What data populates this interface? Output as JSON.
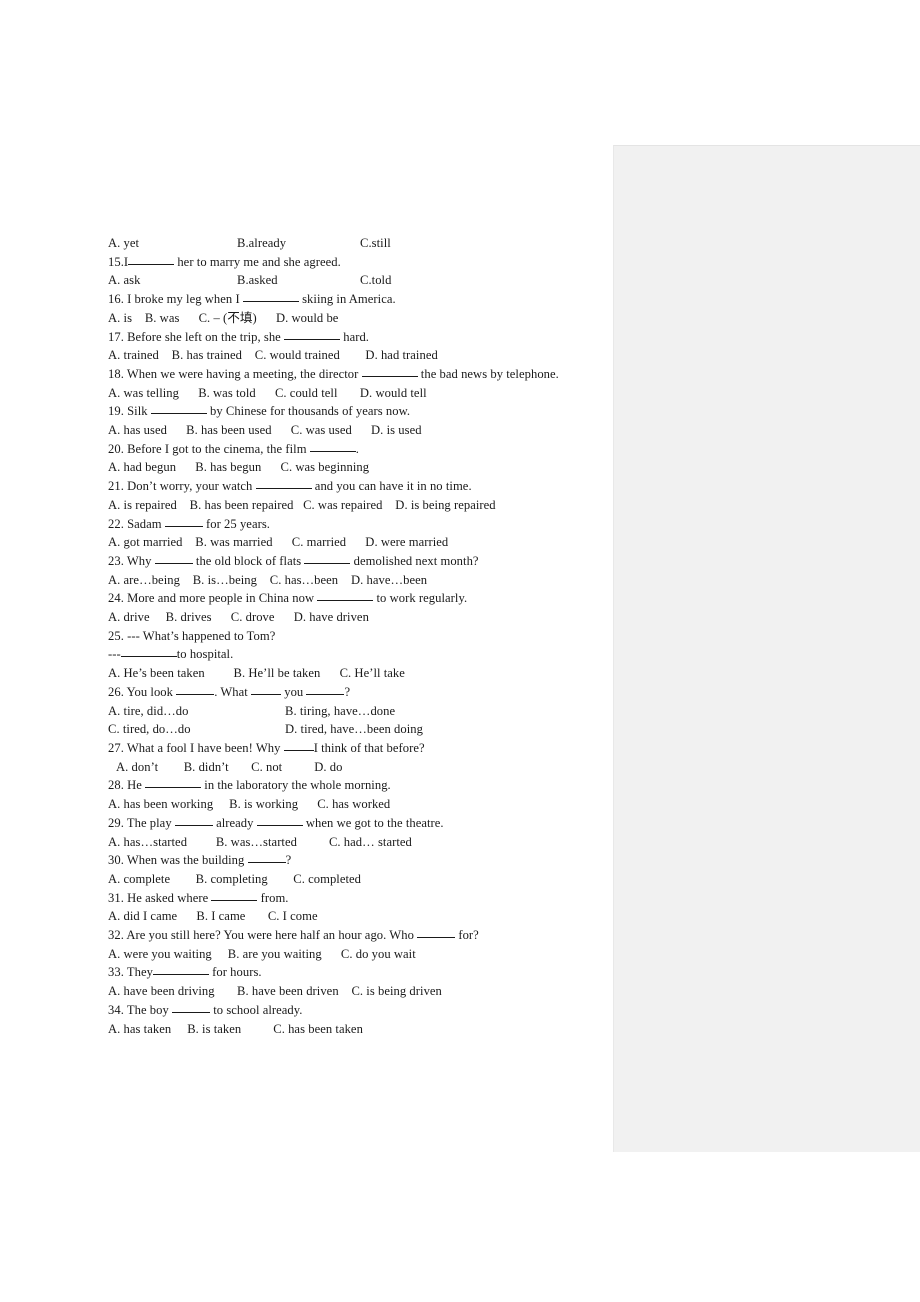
{
  "document": {
    "type": "english-grammar-worksheet",
    "page_background": "#ffffff",
    "side_panel_color": "#f1f1f1",
    "text_color": "#1a1a1a"
  },
  "lines": [
    {
      "id": "l1",
      "kind": "options",
      "text": "A. yet",
      "col2": "B.already",
      "col3": "C.still"
    },
    {
      "id": "l2",
      "kind": "question",
      "num": "15.I",
      "pre": "15.I",
      "post": " her to marry me and she agreed."
    },
    {
      "id": "l3",
      "kind": "options",
      "text": "A. ask",
      "col2": "B.asked",
      "col3": "C.told"
    },
    {
      "id": "l4",
      "kind": "question",
      "pre": "16. I broke my leg when I ",
      "post": " skiing in America."
    },
    {
      "id": "l5",
      "kind": "options",
      "text": "A. is    B. was      C. – (不填)      D. would be"
    },
    {
      "id": "l6",
      "kind": "question",
      "pre": "17. Before she left on the trip, she ",
      "post": " hard."
    },
    {
      "id": "l7",
      "kind": "options",
      "text": "A. trained    B. has trained    C. would trained        D. had trained"
    },
    {
      "id": "l8",
      "kind": "question",
      "pre": "18. When we were having a meeting, the director ",
      "post": " the bad news by telephone."
    },
    {
      "id": "l9",
      "kind": "options",
      "text": "A. was telling      B. was told      C. could tell       D. would tell"
    },
    {
      "id": "l10",
      "kind": "question",
      "pre": "19. Silk ",
      "post": " by Chinese for thousands of years now."
    },
    {
      "id": "l11",
      "kind": "options",
      "text": "A. has used      B. has been used      C. was used      D. is used"
    },
    {
      "id": "l12",
      "kind": "question",
      "pre": "20. Before I got to the cinema, the film ",
      "post": "."
    },
    {
      "id": "l13",
      "kind": "options",
      "text": "A. had begun      B. has begun      C. was beginning"
    },
    {
      "id": "l14",
      "kind": "question",
      "pre": "21. Don’t worry, your watch ",
      "post": " and you can have it in no time."
    },
    {
      "id": "l15",
      "kind": "options",
      "text": "A. is repaired    B. has been repaired   C. was repaired    D. is being repaired"
    },
    {
      "id": "l16",
      "kind": "question",
      "pre": "22. Sadam ",
      "post": " for 25 years."
    },
    {
      "id": "l17",
      "kind": "options",
      "text": "A. got married    B. was married      C. married      D. were married"
    },
    {
      "id": "l18",
      "kind": "question",
      "pre": "23. Why ",
      "mid": " the old block of flats ",
      "post": " demolished next month?"
    },
    {
      "id": "l19",
      "kind": "options",
      "text": "A. are…being    B. is…being    C. has…been    D. have…been"
    },
    {
      "id": "l20",
      "kind": "question",
      "pre": "24. More and more people in China now ",
      "post": " to work regularly."
    },
    {
      "id": "l21",
      "kind": "options",
      "text": "A. drive     B. drives      C. drove      D. have driven"
    },
    {
      "id": "l22",
      "kind": "plain",
      "text": "25. --- What’s happened to Tom?"
    },
    {
      "id": "l23",
      "kind": "question",
      "pre": "---",
      "post": "to hospital."
    },
    {
      "id": "l24",
      "kind": "options",
      "text": "A. He’s been taken         B. He’ll be taken      C. He’ll take"
    },
    {
      "id": "l25",
      "kind": "question",
      "pre": "26. You look ",
      "mid": ". What ",
      "post": " you ",
      "tail": "?"
    },
    {
      "id": "l26",
      "kind": "two-col",
      "left": "A. tire, did…do",
      "right": "B. tiring, have…done"
    },
    {
      "id": "l27",
      "kind": "two-col",
      "left": "C. tired, do…do",
      "right": "D. tired, have…been doing"
    },
    {
      "id": "l28",
      "kind": "question",
      "pre": "27. What a fool I have been! Why ",
      "post": "I think of that before?"
    },
    {
      "id": "l29",
      "kind": "options",
      "indent": true,
      "text": "A. don’t        B. didn’t       C. not          D. do"
    },
    {
      "id": "l30",
      "kind": "question",
      "pre": "28. He ",
      "post": " in the laboratory the whole morning."
    },
    {
      "id": "l31",
      "kind": "options",
      "text": "A. has been working     B. is working      C. has worked"
    },
    {
      "id": "l32",
      "kind": "question",
      "pre": "29. The play ",
      "mid": " already ",
      "post": " when we got to the theatre."
    },
    {
      "id": "l33",
      "kind": "options",
      "text": "A. has…started         B. was…started          C. had… started"
    },
    {
      "id": "l34",
      "kind": "question",
      "pre": "30. When was the building ",
      "post": "?"
    },
    {
      "id": "l35",
      "kind": "options",
      "text": "A. complete        B. completing        C. completed"
    },
    {
      "id": "l36",
      "kind": "question",
      "pre": "31. He asked where ",
      "post": " from."
    },
    {
      "id": "l37",
      "kind": "options",
      "text": "A. did I came      B. I came       C. I come"
    },
    {
      "id": "l38",
      "kind": "question",
      "pre": "32. Are you still here? You were here half an hour ago. Who ",
      "post": " for?"
    },
    {
      "id": "l39",
      "kind": "options",
      "text": "A. were you waiting     B. are you waiting      C. do you wait"
    },
    {
      "id": "l40",
      "kind": "question",
      "pre": "33. They",
      "post": " for hours."
    },
    {
      "id": "l41",
      "kind": "options",
      "text": "A. have been driving       B. have been driven    C. is being driven"
    },
    {
      "id": "l42",
      "kind": "question",
      "pre": "34. The boy ",
      "post": " to school already."
    },
    {
      "id": "l43",
      "kind": "options",
      "text": "A. has taken     B. is taken          C. has been taken"
    }
  ]
}
